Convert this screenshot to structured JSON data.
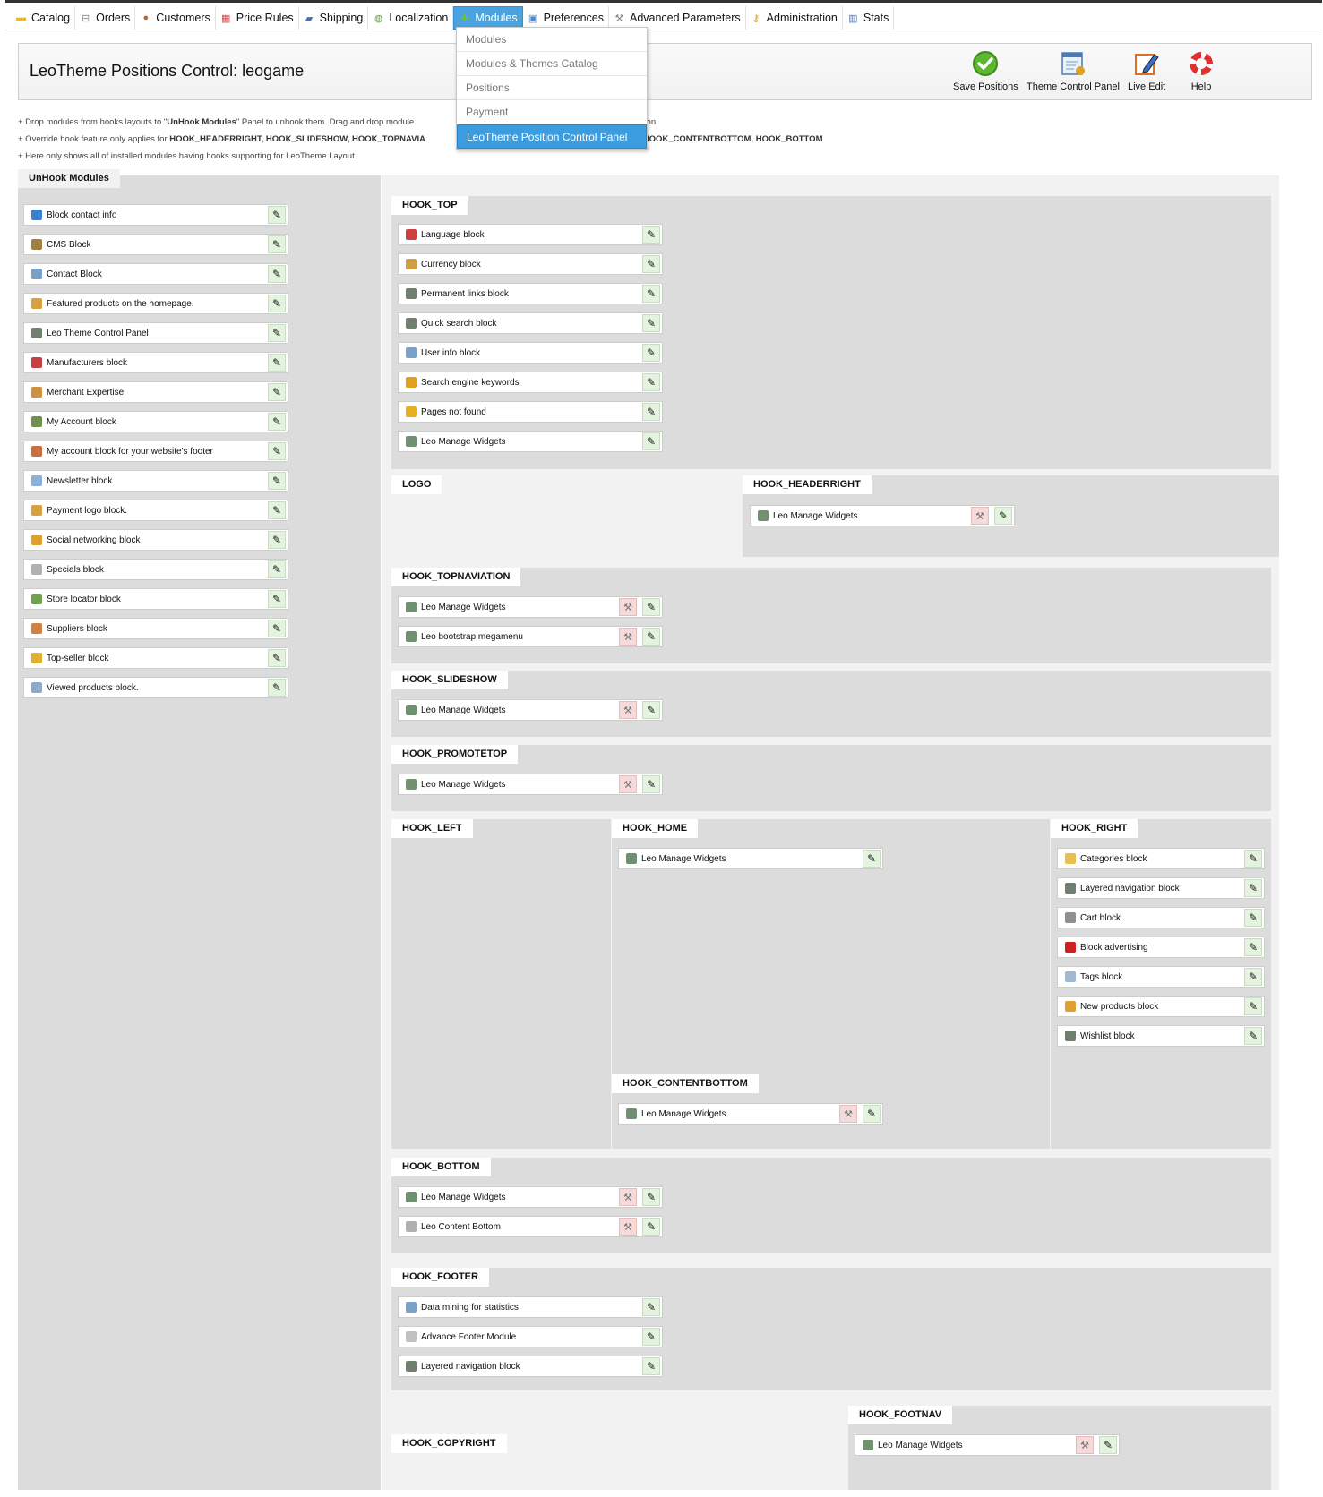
{
  "nav": {
    "items": [
      {
        "label": "Catalog",
        "icon": "folder-icon",
        "color": "#e8b73a"
      },
      {
        "label": "Orders",
        "icon": "cart-icon",
        "color": "#888888"
      },
      {
        "label": "Customers",
        "icon": "user-icon",
        "color": "#b36b3b"
      },
      {
        "label": "Price Rules",
        "icon": "price-tag-icon",
        "color": "#d04040"
      },
      {
        "label": "Shipping",
        "icon": "truck-icon",
        "color": "#4a6fb5"
      },
      {
        "label": "Localization",
        "icon": "globe-icon",
        "color": "#5aa040"
      },
      {
        "label": "Modules",
        "icon": "puzzle-icon",
        "color": "#6fbf3f"
      },
      {
        "label": "Preferences",
        "icon": "preferences-icon",
        "color": "#4a8bd0"
      },
      {
        "label": "Advanced Parameters",
        "icon": "wrench-icon",
        "color": "#888888"
      },
      {
        "label": "Administration",
        "icon": "key-icon",
        "color": "#e0a020"
      },
      {
        "label": "Stats",
        "icon": "bar-chart-icon",
        "color": "#4a6fb5"
      }
    ],
    "active_index": 6,
    "dropdown": [
      "Modules",
      "Modules & Themes Catalog",
      "Positions",
      "Payment",
      "LeoTheme Position Control Panel"
    ],
    "dropdown_selected": 4
  },
  "toolbar": {
    "title": "LeoTheme Positions Control: leogame",
    "save_label": "Save Positions",
    "theme_panel_label": "Theme Control Panel",
    "live_edit_label": "Live Edit",
    "help_label": "Help"
  },
  "notes": {
    "line1_pre": "+ Drop modules from hooks layouts to \"",
    "line1_bold": "UnHook Modules",
    "line1_post": "\" Panel to unhook them. Drag and drop module",
    "line1_tail": "hook position",
    "line2_pre": "+ Override hook feature only applies for ",
    "line2_bold": "HOOK_HEADERRIGHT, HOOK_SLIDESHOW, HOOK_TOPNAVIA",
    "line2_tail": "ETOP, HOOK_CONTENTBOTTOM, HOOK_BOTTOM",
    "line3": "+ Here only shows all of installed modules having hooks supporting for LeoTheme Layout."
  },
  "unhook": {
    "title": "UnHook Modules",
    "modules": [
      {
        "label": "Block contact info",
        "color": "#3a7fd0"
      },
      {
        "label": "CMS Block",
        "color": "#a08040"
      },
      {
        "label": "Contact Block",
        "color": "#7aa0c8"
      },
      {
        "label": "Featured products on the homepage.",
        "color": "#d8a040"
      },
      {
        "label": "Leo Theme Control Panel",
        "color": "#708070"
      },
      {
        "label": "Manufacturers block",
        "color": "#c84040"
      },
      {
        "label": "Merchant Expertise",
        "color": "#d09040"
      },
      {
        "label": "My Account block",
        "color": "#709050"
      },
      {
        "label": "My account block for your website's footer",
        "color": "#c87040"
      },
      {
        "label": "Newsletter block",
        "color": "#8ab0d8"
      },
      {
        "label": "Payment logo block.",
        "color": "#d8a040"
      },
      {
        "label": "Social networking block",
        "color": "#e0a030"
      },
      {
        "label": "Specials block",
        "color": "#b0b0b0"
      },
      {
        "label": "Store locator block",
        "color": "#70a050"
      },
      {
        "label": "Suppliers block",
        "color": "#d08040"
      },
      {
        "label": "Top-seller block",
        "color": "#e0b030"
      },
      {
        "label": "Viewed products block.",
        "color": "#90a8c8"
      }
    ]
  },
  "hooks": {
    "top": {
      "title": "HOOK_TOP",
      "modules": [
        {
          "label": "Language block",
          "color": "#d04040"
        },
        {
          "label": "Currency block",
          "color": "#d0a040"
        },
        {
          "label": "Permanent links block",
          "color": "#708070"
        },
        {
          "label": "Quick search block",
          "color": "#708070"
        },
        {
          "label": "User info block",
          "color": "#7aa0c8"
        },
        {
          "label": "Search engine keywords",
          "color": "#e0a020"
        },
        {
          "label": "Pages not found",
          "color": "#e8b020"
        },
        {
          "label": "Leo Manage Widgets",
          "color": "#709070"
        }
      ]
    },
    "logo": {
      "title": "LOGO"
    },
    "headerright": {
      "title": "HOOK_HEADERRIGHT",
      "modules": [
        {
          "label": "Leo Manage Widgets",
          "color": "#709070"
        }
      ]
    },
    "topnav": {
      "title": "HOOK_TOPNAVIATION",
      "modules": [
        {
          "label": "Leo Manage Widgets",
          "color": "#709070"
        },
        {
          "label": "Leo bootstrap megamenu",
          "color": "#709070"
        }
      ]
    },
    "slideshow": {
      "title": "HOOK_SLIDESHOW",
      "modules": [
        {
          "label": "Leo Manage Widgets",
          "color": "#709070"
        }
      ]
    },
    "promotetop": {
      "title": "HOOK_PROMOTETOP",
      "modules": [
        {
          "label": "Leo Manage Widgets",
          "color": "#709070"
        }
      ]
    },
    "left": {
      "title": "HOOK_LEFT"
    },
    "home": {
      "title": "HOOK_HOME",
      "modules": [
        {
          "label": "Leo Manage Widgets",
          "color": "#709070"
        }
      ]
    },
    "right": {
      "title": "HOOK_RIGHT",
      "modules": [
        {
          "label": "Categories block",
          "color": "#e8c050"
        },
        {
          "label": "Layered navigation block",
          "color": "#708070"
        },
        {
          "label": "Cart block",
          "color": "#909090"
        },
        {
          "label": "Block advertising",
          "color": "#d02020"
        },
        {
          "label": "Tags block",
          "color": "#a0b8d0"
        },
        {
          "label": "New products block",
          "color": "#e0a030"
        },
        {
          "label": "Wishlist block",
          "color": "#708070"
        }
      ]
    },
    "contentbottom": {
      "title": "HOOK_CONTENTBOTTOM",
      "modules": [
        {
          "label": "Leo Manage Widgets",
          "color": "#709070"
        }
      ]
    },
    "bottom": {
      "title": "HOOK_BOTTOM",
      "modules": [
        {
          "label": "Leo Manage Widgets",
          "color": "#709070"
        },
        {
          "label": "Leo Content Bottom",
          "color": "#b0b0b0"
        }
      ]
    },
    "footer": {
      "title": "HOOK_FOOTER",
      "modules": [
        {
          "label": "Data mining for statistics",
          "color": "#7aa0c8"
        },
        {
          "label": "Advance Footer Module",
          "color": "#c0c0c0"
        },
        {
          "label": "Layered navigation block",
          "color": "#708070"
        }
      ]
    },
    "footnav": {
      "title": "HOOK_FOOTNAV",
      "modules": [
        {
          "label": "Leo Manage Widgets",
          "color": "#709070"
        }
      ]
    },
    "copyright": {
      "title": "HOOK_COPYRIGHT"
    }
  }
}
